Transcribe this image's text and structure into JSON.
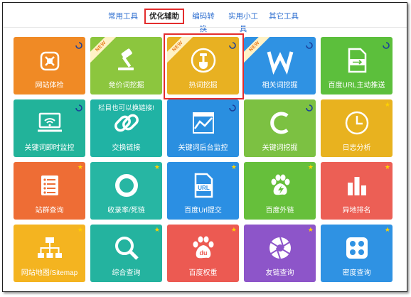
{
  "tabs": [
    {
      "label": "常用工具",
      "active": false
    },
    {
      "label": "优化辅助",
      "active": true
    },
    {
      "label": "编码转换",
      "active": false
    },
    {
      "label": "实用小工具",
      "active": false
    },
    {
      "label": "其它工具",
      "active": false
    }
  ],
  "colors": {
    "accent": "#e32d2d",
    "tab_link": "#2f6fd0",
    "badge_star": "#ffd200"
  },
  "tiles": [
    {
      "label": "网站体检",
      "color": "#f08a25",
      "icon": "medkit-icon",
      "badge": "spin"
    },
    {
      "label": "竞价词挖掘",
      "color": "#8cc63e",
      "icon": "gavel-icon",
      "badge": "none",
      "new": "NEW"
    },
    {
      "label": "热词挖掘",
      "color": "#e8b122",
      "icon": "shovel-icon",
      "badge": "spin",
      "new": "NEW"
    },
    {
      "label": "相关词挖掘",
      "color": "#2f92e3",
      "icon": "w-letter-icon",
      "badge": "spin",
      "new": "NEW"
    },
    {
      "label": "百度URL主动推送",
      "color": "#5cbf3c",
      "icon": "url-push-icon",
      "badge": "spin"
    },
    {
      "label": "关键词即时监控",
      "color": "#22b39a",
      "icon": "monitor-wifi-icon",
      "badge": "spin"
    },
    {
      "label": "交换链接",
      "color": "#20b3a4",
      "icon": "chain-link-icon",
      "badge": "none",
      "note": "栏目也可以换链接!"
    },
    {
      "label": "关键词后台监控",
      "color": "#2a8fe0",
      "icon": "chart-map-icon",
      "badge": "spin"
    },
    {
      "label": "关键词挖掘",
      "color": "#7cc142",
      "icon": "c-letter-icon",
      "badge": "spin"
    },
    {
      "label": "日志分析",
      "color": "#e8b21f",
      "icon": "clock-icon",
      "badge": "star"
    },
    {
      "label": "站群查询",
      "color": "#ee6d35",
      "icon": "list-icon",
      "badge": "star"
    },
    {
      "label": "收录率/死链",
      "color": "#27b6a3",
      "icon": "ring-icon",
      "badge": "star"
    },
    {
      "label": "百度Url提交",
      "color": "#2b8fe3",
      "icon": "url-file-icon",
      "badge": "star"
    },
    {
      "label": "百度外链",
      "color": "#66bf3b",
      "icon": "paw-bolt-icon",
      "badge": "star"
    },
    {
      "label": "异地排名",
      "color": "#ec5f55",
      "icon": "bars-icon",
      "badge": "star"
    },
    {
      "label": "网站地图/Sitemap",
      "color": "#f4b420",
      "icon": "sitemap-icon",
      "badge": "star"
    },
    {
      "label": "综合查询",
      "color": "#24b39f",
      "icon": "magnifier-icon",
      "badge": "star"
    },
    {
      "label": "百度权重",
      "color": "#ec5a52",
      "icon": "baidu-paw-icon",
      "badge": "star"
    },
    {
      "label": "友链查询",
      "color": "#8d55c9",
      "icon": "aperture-icon",
      "badge": "star"
    },
    {
      "label": "密度查询",
      "color": "#2f92e3",
      "icon": "dots-grid-icon",
      "badge": "star"
    }
  ],
  "icon_text": {
    "url": "URL",
    "du": "du"
  }
}
